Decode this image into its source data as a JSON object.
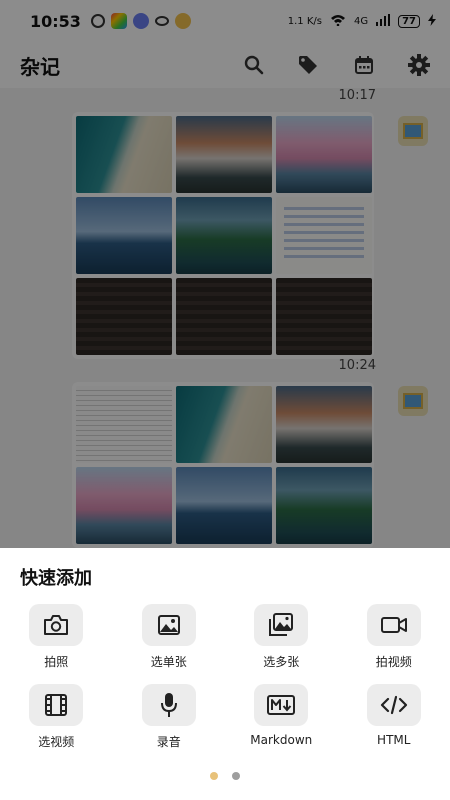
{
  "status_bar": {
    "time": "10:53",
    "net_speed": "1.1 K/s",
    "network": "4G",
    "battery": "77"
  },
  "app_bar": {
    "title": "杂记",
    "icons": [
      "search-icon",
      "tag-icon",
      "calendar-icon",
      "gear-icon"
    ]
  },
  "notes": [
    {
      "time": "10:17",
      "images": [
        "beach",
        "mountain",
        "cherry",
        "coast",
        "island",
        "doc",
        "dark",
        "dark",
        "dark"
      ]
    },
    {
      "time": "10:24",
      "images": [
        "form",
        "beach",
        "mountain",
        "cherry",
        "coast",
        "island"
      ]
    }
  ],
  "quick_add": {
    "title": "快速添加",
    "actions": [
      {
        "label": "拍照",
        "icon": "camera-icon"
      },
      {
        "label": "选单张",
        "icon": "single-image-icon"
      },
      {
        "label": "选多张",
        "icon": "multi-image-icon"
      },
      {
        "label": "拍视频",
        "icon": "video-camera-icon"
      },
      {
        "label": "选视频",
        "icon": "film-icon"
      },
      {
        "label": "录音",
        "icon": "microphone-icon"
      },
      {
        "label": "Markdown",
        "icon": "markdown-icon"
      },
      {
        "label": "HTML",
        "icon": "code-icon"
      }
    ]
  },
  "pager": {
    "active_color": "#e8c27a",
    "inactive_color": "#9e9e9e"
  }
}
